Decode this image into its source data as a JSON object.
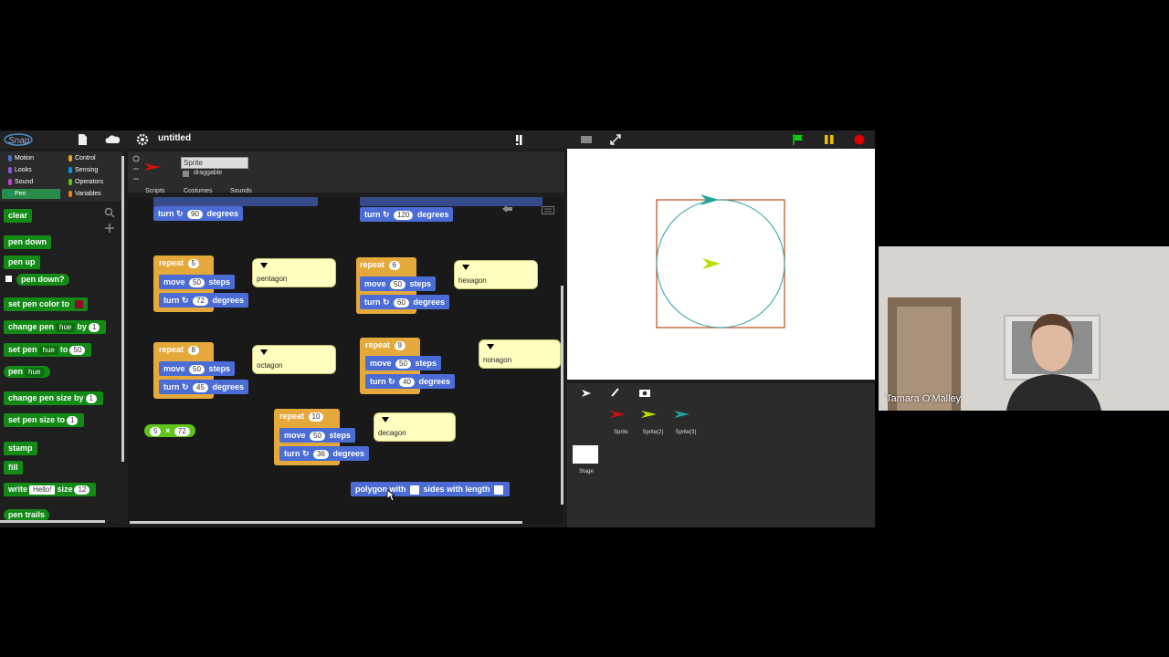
{
  "app": {
    "title": "untitled"
  },
  "categories": [
    {
      "label": "Motion",
      "color": "#4a6cd4"
    },
    {
      "label": "Looks",
      "color": "#8a55d7"
    },
    {
      "label": "Sound",
      "color": "#bb42c3"
    },
    {
      "label": "Pen",
      "color": "#0e9a6c"
    },
    {
      "label": "Control",
      "color": "#e1a91a"
    },
    {
      "label": "Sensing",
      "color": "#0494dc"
    },
    {
      "label": "Operators",
      "color": "#62c213"
    },
    {
      "label": "Variables",
      "color": "#ee7d16"
    }
  ],
  "sprite": {
    "name": "Sprite",
    "draggable": "draggable"
  },
  "tabs": [
    "Scripts",
    "Costumes",
    "Sounds"
  ],
  "palette": {
    "clear": "clear",
    "pen_down": "pen down",
    "pen_up": "pen up",
    "pen_down_q": "pen down?",
    "set_pen_color_to": "set pen color to",
    "change_pen": "change pen",
    "hue1": "hue",
    "by": "by",
    "by_val": "1",
    "set_pen": "set pen",
    "hue2": "hue",
    "to": "to",
    "to_val": "50",
    "pen": "pen",
    "hue3": "hue",
    "change_pen_size_by": "change pen size by",
    "size_by_val": "1",
    "set_pen_size_to": "set pen size to",
    "size_to_val": "1",
    "stamp": "stamp",
    "fill": "fill",
    "write": "write",
    "hello": "Hello!",
    "size": "size",
    "size_val": "12",
    "pen_trails": "pen trails"
  },
  "scripts": {
    "top_left_turn": {
      "turn": "turn",
      "deg": "90",
      "degrees": "degrees"
    },
    "top_right_turn": {
      "turn": "turn",
      "deg": "120",
      "degrees": "degrees"
    },
    "pentagon": {
      "repeat": "repeat",
      "n": "5",
      "move": "move",
      "steps_val": "50",
      "steps": "steps",
      "turn": "turn",
      "deg": "72",
      "degrees": "degrees",
      "note": "pentagon"
    },
    "hexagon": {
      "repeat": "repeat",
      "n": "6",
      "move": "move",
      "steps_val": "50",
      "steps": "steps",
      "turn": "turn",
      "deg": "60",
      "degrees": "degrees",
      "note": "hexagon"
    },
    "octagon": {
      "repeat": "repeat",
      "n": "8",
      "move": "move",
      "steps_val": "50",
      "steps": "steps",
      "turn": "turn",
      "deg": "45",
      "degrees": "degrees",
      "note": "octagon"
    },
    "nonagon": {
      "repeat": "repeat",
      "n": "9",
      "move": "move",
      "steps_val": "50",
      "steps": "steps",
      "turn": "turn",
      "deg": "40",
      "degrees": "degrees",
      "note": "nonagon"
    },
    "decagon": {
      "repeat": "repeat",
      "n": "10",
      "move": "move",
      "steps_val": "50",
      "steps": "steps",
      "turn": "turn",
      "deg": "36",
      "degrees": "degrees",
      "note": "decagon"
    },
    "multiply": {
      "a": "5",
      "op": "×",
      "b": "72"
    },
    "polygon": {
      "label1": "polygon with",
      "label2": "sides with length"
    }
  },
  "corral": {
    "sprites": [
      "Sprite",
      "Sprite(2)",
      "Sprite(3)"
    ],
    "stage": "Stage"
  },
  "video": {
    "participant": "Tamara O'Malley"
  }
}
